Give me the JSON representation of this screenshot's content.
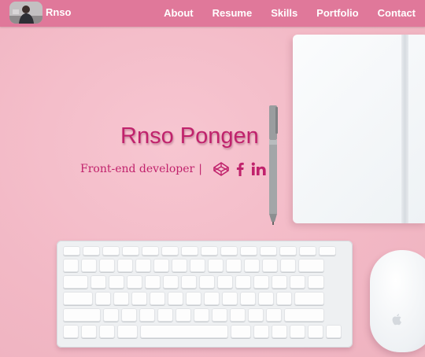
{
  "nav": {
    "brand": "Rnso",
    "links": [
      "About",
      "Resume",
      "Skills",
      "Portfolio",
      "Contact"
    ]
  },
  "hero": {
    "name": "Rnso Pongen",
    "subtitle": "Front-end developer",
    "separator": "|",
    "social": [
      "codepen-icon",
      "facebook-icon",
      "linkedin-icon"
    ]
  },
  "colors": {
    "navbar": "#e0789a",
    "accent": "#c0226c",
    "background": "#f4bfca"
  }
}
